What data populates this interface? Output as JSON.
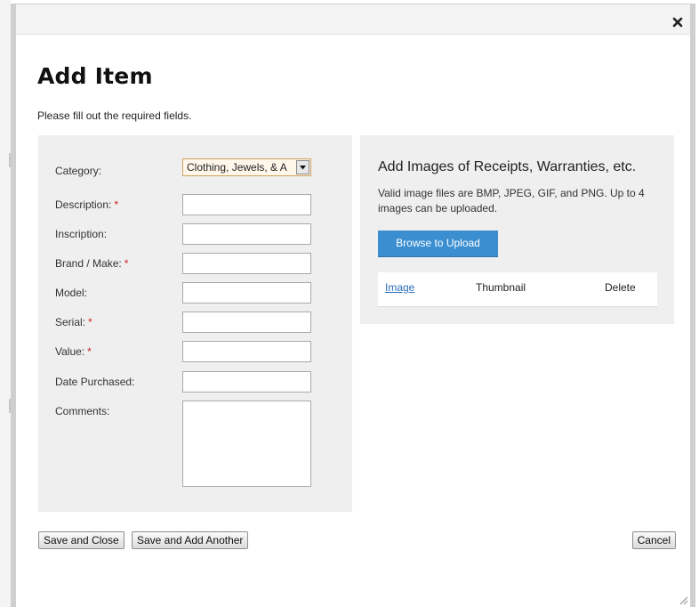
{
  "dialog": {
    "title": "Add Item",
    "subtitle": "Please fill out the required fields."
  },
  "form": {
    "category": {
      "label": "Category:",
      "value": "Clothing, Jewels, & A"
    },
    "fields": [
      {
        "label": "Description:",
        "required": true,
        "value": ""
      },
      {
        "label": "Inscription:",
        "required": false,
        "value": ""
      },
      {
        "label": "Brand / Make:",
        "required": true,
        "value": ""
      },
      {
        "label": "Model:",
        "required": false,
        "value": ""
      },
      {
        "label": "Serial:",
        "required": true,
        "value": ""
      },
      {
        "label": "Value:",
        "required": true,
        "value": ""
      },
      {
        "label": "Date Purchased:",
        "required": false,
        "value": ""
      }
    ],
    "comments": {
      "label": "Comments:",
      "value": ""
    },
    "required_marker": "*"
  },
  "images": {
    "heading": "Add Images of Receipts, Warranties, etc.",
    "description": "Valid image files are BMP, JPEG, GIF, and PNG. Up to 4 images can be uploaded.",
    "browse_label": "Browse to Upload",
    "columns": {
      "image": "Image",
      "thumbnail": "Thumbnail",
      "delete": "Delete"
    }
  },
  "buttons": {
    "save_close": "Save and Close",
    "save_add": "Save and Add Another",
    "cancel": "Cancel"
  },
  "icons": {
    "close": "close-icon",
    "dropdown": "chevron-down-icon",
    "resize": "resize-grip-icon"
  },
  "colors": {
    "primary_button": "#3b8fd1",
    "required": "#cc2222",
    "link": "#2a6ebb",
    "panel": "#efefef"
  }
}
